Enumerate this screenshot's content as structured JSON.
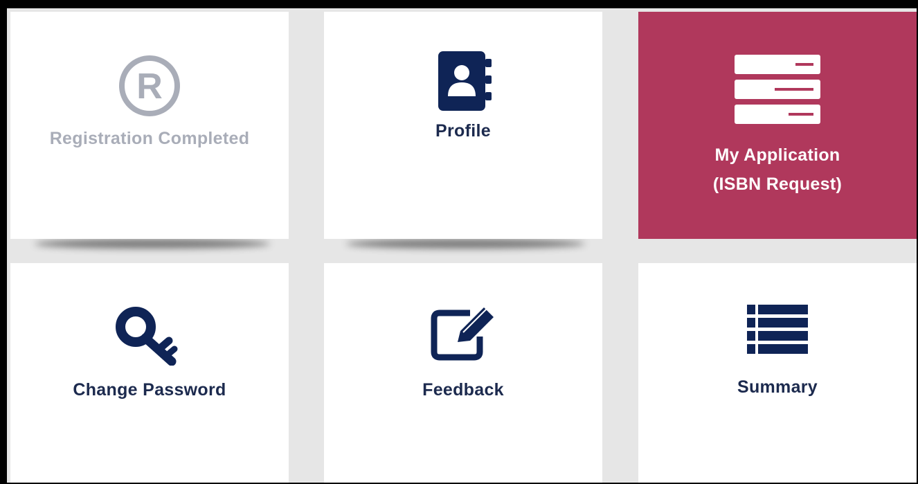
{
  "tiles": {
    "registration": {
      "label": "Registration Completed",
      "icon": "registered-icon",
      "state": "disabled"
    },
    "profile": {
      "label": "Profile",
      "icon": "address-book-icon"
    },
    "my_application": {
      "line1": "My Application",
      "line2": "(ISBN Request)",
      "icon": "server-stack-icon",
      "state": "active"
    },
    "change_password": {
      "label": "Change Password",
      "icon": "key-icon"
    },
    "feedback": {
      "label": "Feedback",
      "icon": "edit-icon"
    },
    "summary": {
      "label": "Summary",
      "icon": "list-icon"
    }
  },
  "colors": {
    "navy": "#0f2456",
    "active_tile": "#b0385c",
    "disabled_text": "#a9adb8",
    "background": "#e6e6e6"
  }
}
